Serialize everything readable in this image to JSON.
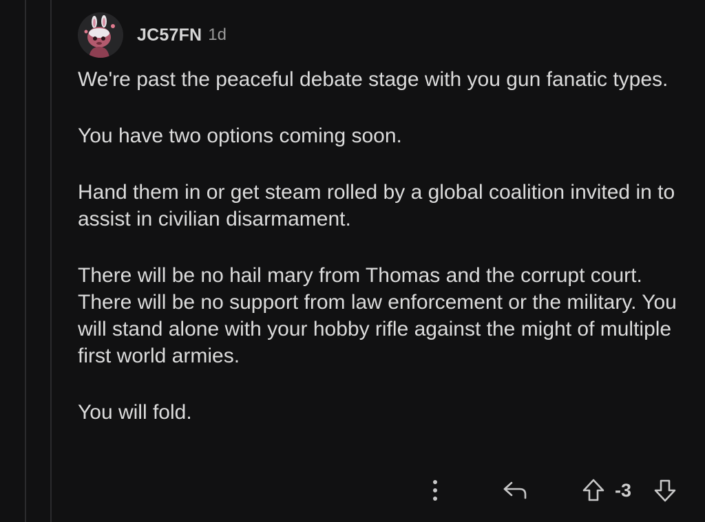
{
  "comment": {
    "author": "JC57FN",
    "timestamp": "1d",
    "paragraphs": [
      "We're past the peaceful debate stage with you gun fanatic types.",
      "You have two options coming soon.",
      "Hand them in or get steam rolled by a global coalition invited in to assist in civilian disarmament.",
      "There will be no hail mary from Thomas and the corrupt court. There will be no support from law enforcement or the military. You will stand alone with your hobby rifle against the might of multiple first world armies.",
      "You will fold."
    ],
    "score": "-3"
  },
  "icons": {
    "more": "more-vertical-icon",
    "reply": "reply-arrow-icon",
    "upvote": "upvote-arrow-icon",
    "downvote": "downvote-arrow-icon"
  },
  "colors": {
    "background": "#111112",
    "text": "#dcdcdc",
    "muted": "#9a9a9a",
    "thread_line": "#2b2b2d"
  }
}
